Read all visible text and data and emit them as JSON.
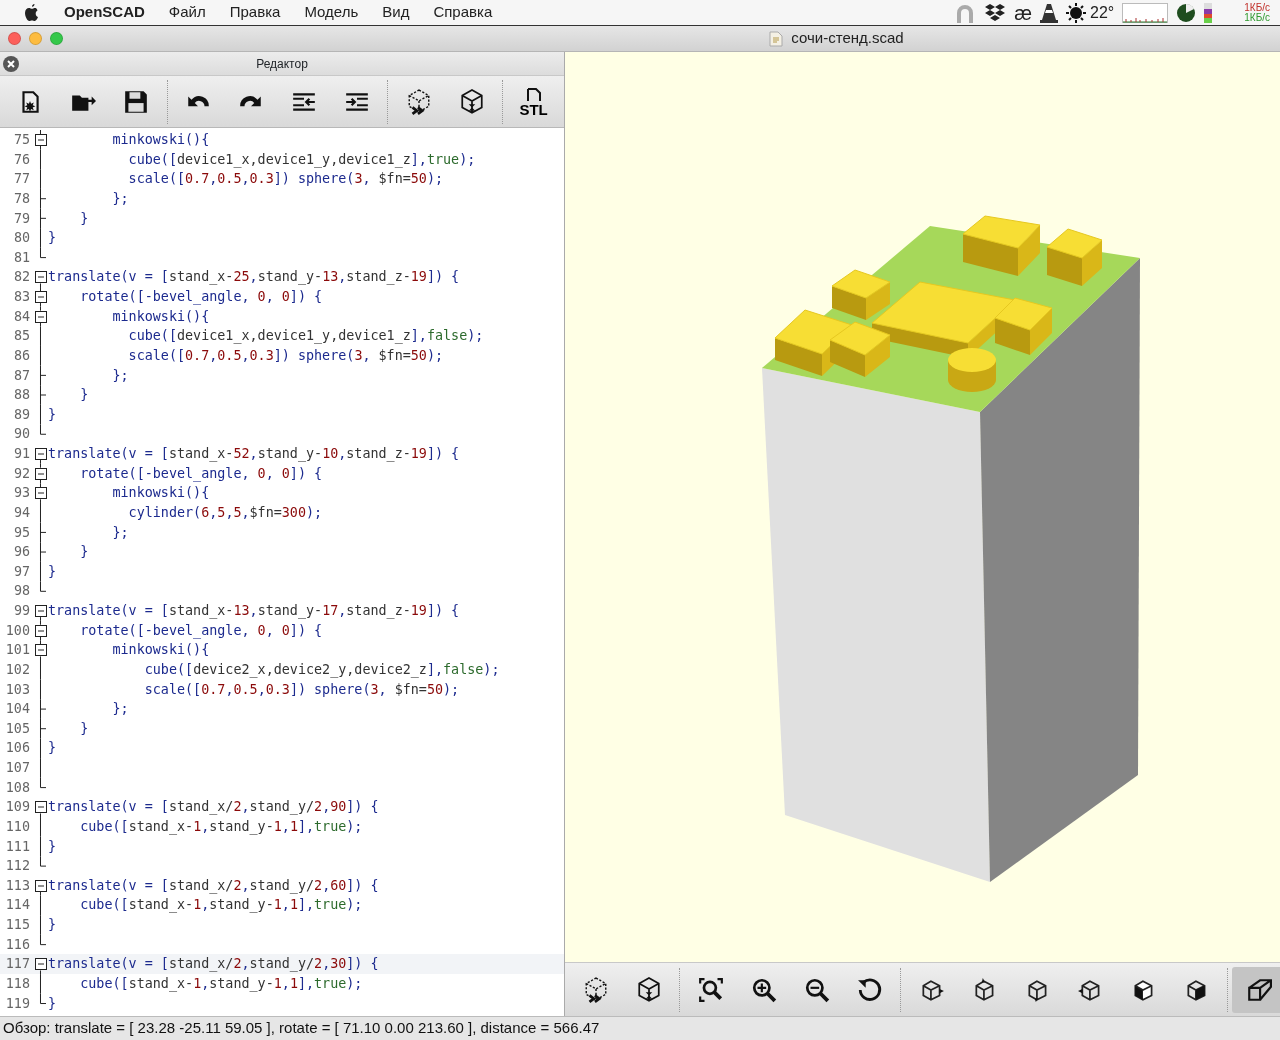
{
  "menu_bar": {
    "app": "OpenSCAD",
    "menus": [
      "Файл",
      "Правка",
      "Модель",
      "Вид",
      "Справка"
    ],
    "status": {
      "text_icon": "æ",
      "temperature": "22°",
      "upload": "1КБ/с",
      "download": "1КБ/с"
    }
  },
  "window": {
    "title": "сочи-стенд.scad"
  },
  "editor": {
    "title": "Редактор",
    "export_label": "STL",
    "lines": [
      {
        "number": "75",
        "kind": "fold-start",
        "current": false,
        "tokens": [
          {
            "text": "        minkowski(){",
            "kind": "function"
          }
        ]
      },
      {
        "number": "76",
        "kind": "fold-line",
        "current": false,
        "tokens": [
          {
            "text": "          cube([",
            "kind": "function"
          },
          {
            "text": "device1_x,device1_y,device1_z",
            "kind": "variable"
          },
          {
            "text": "],",
            "kind": "function"
          },
          {
            "text": "true",
            "kind": "boolean"
          },
          {
            "text": ");",
            "kind": "function"
          }
        ]
      },
      {
        "number": "77",
        "kind": "fold-line",
        "current": false,
        "tokens": [
          {
            "text": "          scale([",
            "kind": "function"
          },
          {
            "text": "0.7",
            "kind": "number"
          },
          {
            "text": ",",
            "kind": "function"
          },
          {
            "text": "0.5",
            "kind": "number"
          },
          {
            "text": ",",
            "kind": "function"
          },
          {
            "text": "0.3",
            "kind": "number"
          },
          {
            "text": "]) sphere(",
            "kind": "function"
          },
          {
            "text": "3",
            "kind": "number"
          },
          {
            "text": ", ",
            "kind": "function"
          },
          {
            "text": "$fn=",
            "kind": "variable"
          },
          {
            "text": "50",
            "kind": "number"
          },
          {
            "text": ");",
            "kind": "function"
          }
        ]
      },
      {
        "number": "78",
        "kind": "fold-tick",
        "current": false,
        "tokens": [
          {
            "text": "        };",
            "kind": "function"
          }
        ]
      },
      {
        "number": "79",
        "kind": "fold-tick",
        "current": false,
        "tokens": [
          {
            "text": "    }",
            "kind": "function"
          }
        ]
      },
      {
        "number": "80",
        "kind": "fold-line",
        "current": false,
        "tokens": [
          {
            "text": "}",
            "kind": "function"
          }
        ]
      },
      {
        "number": "81",
        "kind": "fold-end",
        "current": false
      },
      {
        "number": "82",
        "kind": "fold-start",
        "current": false,
        "tokens": [
          {
            "text": "translate(v = [",
            "kind": "function"
          },
          {
            "text": "stand_x-",
            "kind": "variable"
          },
          {
            "text": "25",
            "kind": "number"
          },
          {
            "text": ",",
            "kind": "function"
          },
          {
            "text": "stand_y-",
            "kind": "variable"
          },
          {
            "text": "13",
            "kind": "number"
          },
          {
            "text": ",",
            "kind": "function"
          },
          {
            "text": "stand_z-",
            "kind": "variable"
          },
          {
            "text": "19",
            "kind": "number"
          },
          {
            "text": "]) {",
            "kind": "function"
          }
        ]
      },
      {
        "number": "83",
        "kind": "fold-start",
        "current": false,
        "tokens": [
          {
            "text": "    rotate([-bevel_angle, ",
            "kind": "function"
          },
          {
            "text": "0",
            "kind": "number"
          },
          {
            "text": ", ",
            "kind": "function"
          },
          {
            "text": "0",
            "kind": "number"
          },
          {
            "text": "]) {",
            "kind": "function"
          }
        ]
      },
      {
        "number": "84",
        "kind": "fold-start",
        "current": false,
        "tokens": [
          {
            "text": "        minkowski(){",
            "kind": "function"
          }
        ]
      },
      {
        "number": "85",
        "kind": "fold-line",
        "current": false,
        "tokens": [
          {
            "text": "          cube([",
            "kind": "function"
          },
          {
            "text": "device1_x,device1_y,device1_z",
            "kind": "variable"
          },
          {
            "text": "],",
            "kind": "function"
          },
          {
            "text": "false",
            "kind": "boolean"
          },
          {
            "text": ");",
            "kind": "function"
          }
        ]
      },
      {
        "number": "86",
        "kind": "fold-line",
        "current": false,
        "tokens": [
          {
            "text": "          scale([",
            "kind": "function"
          },
          {
            "text": "0.7",
            "kind": "number"
          },
          {
            "text": ",",
            "kind": "function"
          },
          {
            "text": "0.5",
            "kind": "number"
          },
          {
            "text": ",",
            "kind": "function"
          },
          {
            "text": "0.3",
            "kind": "number"
          },
          {
            "text": "]) sphere(",
            "kind": "function"
          },
          {
            "text": "3",
            "kind": "number"
          },
          {
            "text": ", ",
            "kind": "function"
          },
          {
            "text": "$fn=",
            "kind": "variable"
          },
          {
            "text": "50",
            "kind": "number"
          },
          {
            "text": ");",
            "kind": "function"
          }
        ]
      },
      {
        "number": "87",
        "kind": "fold-tick",
        "current": false,
        "tokens": [
          {
            "text": "        };",
            "kind": "function"
          }
        ]
      },
      {
        "number": "88",
        "kind": "fold-tick",
        "current": false,
        "tokens": [
          {
            "text": "    }",
            "kind": "function"
          }
        ]
      },
      {
        "number": "89",
        "kind": "fold-line",
        "current": false,
        "tokens": [
          {
            "text": "}",
            "kind": "function"
          }
        ]
      },
      {
        "number": "90",
        "kind": "fold-end",
        "current": false
      },
      {
        "number": "91",
        "kind": "fold-start",
        "current": false,
        "tokens": [
          {
            "text": "translate(v = [",
            "kind": "function"
          },
          {
            "text": "stand_x-",
            "kind": "variable"
          },
          {
            "text": "52",
            "kind": "number"
          },
          {
            "text": ",",
            "kind": "function"
          },
          {
            "text": "stand_y-",
            "kind": "variable"
          },
          {
            "text": "10",
            "kind": "number"
          },
          {
            "text": ",",
            "kind": "function"
          },
          {
            "text": "stand_z-",
            "kind": "variable"
          },
          {
            "text": "19",
            "kind": "number"
          },
          {
            "text": "]) {",
            "kind": "function"
          }
        ]
      },
      {
        "number": "92",
        "kind": "fold-start",
        "current": false,
        "tokens": [
          {
            "text": "    rotate([-bevel_angle, ",
            "kind": "function"
          },
          {
            "text": "0",
            "kind": "number"
          },
          {
            "text": ", ",
            "kind": "function"
          },
          {
            "text": "0",
            "kind": "number"
          },
          {
            "text": "]) {",
            "kind": "function"
          }
        ]
      },
      {
        "number": "93",
        "kind": "fold-start",
        "current": false,
        "tokens": [
          {
            "text": "        minkowski(){",
            "kind": "function"
          }
        ]
      },
      {
        "number": "94",
        "kind": "fold-line",
        "current": false,
        "tokens": [
          {
            "text": "          cylinder(",
            "kind": "function"
          },
          {
            "text": "6",
            "kind": "number"
          },
          {
            "text": ",",
            "kind": "function"
          },
          {
            "text": "5",
            "kind": "number"
          },
          {
            "text": ",",
            "kind": "function"
          },
          {
            "text": "5",
            "kind": "number"
          },
          {
            "text": ",",
            "kind": "function"
          },
          {
            "text": "$fn=",
            "kind": "variable"
          },
          {
            "text": "300",
            "kind": "number"
          },
          {
            "text": ");",
            "kind": "function"
          }
        ]
      },
      {
        "number": "95",
        "kind": "fold-tick",
        "current": false,
        "tokens": [
          {
            "text": "        };",
            "kind": "function"
          }
        ]
      },
      {
        "number": "96",
        "kind": "fold-tick",
        "current": false,
        "tokens": [
          {
            "text": "    }",
            "kind": "function"
          }
        ]
      },
      {
        "number": "97",
        "kind": "fold-line",
        "current": false,
        "tokens": [
          {
            "text": "}",
            "kind": "function"
          }
        ]
      },
      {
        "number": "98",
        "kind": "fold-end",
        "current": false
      },
      {
        "number": "99",
        "kind": "fold-start",
        "current": false,
        "tokens": [
          {
            "text": "translate(v = [",
            "kind": "function"
          },
          {
            "text": "stand_x-",
            "kind": "variable"
          },
          {
            "text": "13",
            "kind": "number"
          },
          {
            "text": ",",
            "kind": "function"
          },
          {
            "text": "stand_y-",
            "kind": "variable"
          },
          {
            "text": "17",
            "kind": "number"
          },
          {
            "text": ",",
            "kind": "function"
          },
          {
            "text": "stand_z-",
            "kind": "variable"
          },
          {
            "text": "19",
            "kind": "number"
          },
          {
            "text": "]) {",
            "kind": "function"
          }
        ]
      },
      {
        "number": "100",
        "kind": "fold-start",
        "current": false,
        "tokens": [
          {
            "text": "    rotate([-bevel_angle, ",
            "kind": "function"
          },
          {
            "text": "0",
            "kind": "number"
          },
          {
            "text": ", ",
            "kind": "function"
          },
          {
            "text": "0",
            "kind": "number"
          },
          {
            "text": "]) {",
            "kind": "function"
          }
        ]
      },
      {
        "number": "101",
        "kind": "fold-start",
        "current": false,
        "tokens": [
          {
            "text": "        minkowski(){",
            "kind": "function"
          }
        ]
      },
      {
        "number": "102",
        "kind": "fold-line",
        "current": false,
        "tokens": [
          {
            "text": "            cube([",
            "kind": "function"
          },
          {
            "text": "device2_x,device2_y,device2_z",
            "kind": "variable"
          },
          {
            "text": "],",
            "kind": "function"
          },
          {
            "text": "false",
            "kind": "boolean"
          },
          {
            "text": ");",
            "kind": "function"
          }
        ]
      },
      {
        "number": "103",
        "kind": "fold-line",
        "current": false,
        "tokens": [
          {
            "text": "            scale([",
            "kind": "function"
          },
          {
            "text": "0.7",
            "kind": "number"
          },
          {
            "text": ",",
            "kind": "function"
          },
          {
            "text": "0.5",
            "kind": "number"
          },
          {
            "text": ",",
            "kind": "function"
          },
          {
            "text": "0.3",
            "kind": "number"
          },
          {
            "text": "]) sphere(",
            "kind": "function"
          },
          {
            "text": "3",
            "kind": "number"
          },
          {
            "text": ", ",
            "kind": "function"
          },
          {
            "text": "$fn=",
            "kind": "variable"
          },
          {
            "text": "50",
            "kind": "number"
          },
          {
            "text": ");",
            "kind": "function"
          }
        ]
      },
      {
        "number": "104",
        "kind": "fold-tick",
        "current": false,
        "tokens": [
          {
            "text": "        };",
            "kind": "function"
          }
        ]
      },
      {
        "number": "105",
        "kind": "fold-tick",
        "current": false,
        "tokens": [
          {
            "text": "    }",
            "kind": "function"
          }
        ]
      },
      {
        "number": "106",
        "kind": "fold-line",
        "current": false,
        "tokens": [
          {
            "text": "}",
            "kind": "function"
          }
        ]
      },
      {
        "number": "107",
        "kind": "fold-line",
        "current": false
      },
      {
        "number": "108",
        "kind": "fold-end",
        "current": false
      },
      {
        "number": "109",
        "kind": "fold-start",
        "current": false,
        "tokens": [
          {
            "text": "translate(v = [",
            "kind": "function"
          },
          {
            "text": "stand_x/",
            "kind": "variable"
          },
          {
            "text": "2",
            "kind": "number"
          },
          {
            "text": ",",
            "kind": "function"
          },
          {
            "text": "stand_y/",
            "kind": "variable"
          },
          {
            "text": "2",
            "kind": "number"
          },
          {
            "text": ",",
            "kind": "function"
          },
          {
            "text": "90",
            "kind": "number"
          },
          {
            "text": "]) {",
            "kind": "function"
          }
        ]
      },
      {
        "number": "110",
        "kind": "fold-line",
        "current": false,
        "tokens": [
          {
            "text": "    cube([",
            "kind": "function"
          },
          {
            "text": "stand_x-",
            "kind": "variable"
          },
          {
            "text": "1",
            "kind": "number"
          },
          {
            "text": ",",
            "kind": "function"
          },
          {
            "text": "stand_y-",
            "kind": "variable"
          },
          {
            "text": "1",
            "kind": "number"
          },
          {
            "text": ",",
            "kind": "function"
          },
          {
            "text": "1",
            "kind": "number"
          },
          {
            "text": "],",
            "kind": "function"
          },
          {
            "text": "true",
            "kind": "boolean"
          },
          {
            "text": ");",
            "kind": "function"
          }
        ]
      },
      {
        "number": "111",
        "kind": "fold-line",
        "current": false,
        "tokens": [
          {
            "text": "}",
            "kind": "function"
          }
        ]
      },
      {
        "number": "112",
        "kind": "fold-end",
        "current": false
      },
      {
        "number": "113",
        "kind": "fold-start",
        "current": false,
        "tokens": [
          {
            "text": "translate(v = [",
            "kind": "function"
          },
          {
            "text": "stand_x/",
            "kind": "variable"
          },
          {
            "text": "2",
            "kind": "number"
          },
          {
            "text": ",",
            "kind": "function"
          },
          {
            "text": "stand_y/",
            "kind": "variable"
          },
          {
            "text": "2",
            "kind": "number"
          },
          {
            "text": ",",
            "kind": "function"
          },
          {
            "text": "60",
            "kind": "number"
          },
          {
            "text": "]) {",
            "kind": "function"
          }
        ]
      },
      {
        "number": "114",
        "kind": "fold-line",
        "current": false,
        "tokens": [
          {
            "text": "    cube([",
            "kind": "function"
          },
          {
            "text": "stand_x-",
            "kind": "variable"
          },
          {
            "text": "1",
            "kind": "number"
          },
          {
            "text": ",",
            "kind": "function"
          },
          {
            "text": "stand_y-",
            "kind": "variable"
          },
          {
            "text": "1",
            "kind": "number"
          },
          {
            "text": ",",
            "kind": "function"
          },
          {
            "text": "1",
            "kind": "number"
          },
          {
            "text": "],",
            "kind": "function"
          },
          {
            "text": "true",
            "kind": "boolean"
          },
          {
            "text": ");",
            "kind": "function"
          }
        ]
      },
      {
        "number": "115",
        "kind": "fold-line",
        "current": false,
        "tokens": [
          {
            "text": "}",
            "kind": "function"
          }
        ]
      },
      {
        "number": "116",
        "kind": "fold-end",
        "current": false
      },
      {
        "number": "117",
        "kind": "fold-start",
        "current": true,
        "tokens": [
          {
            "text": "translate(v = [",
            "kind": "function"
          },
          {
            "text": "stand_x/",
            "kind": "variable"
          },
          {
            "text": "2",
            "kind": "number"
          },
          {
            "text": ",",
            "kind": "function"
          },
          {
            "text": "stand_y/",
            "kind": "variable"
          },
          {
            "text": "2",
            "kind": "number"
          },
          {
            "text": ",",
            "kind": "function"
          },
          {
            "text": "30",
            "kind": "number"
          },
          {
            "text": "]) {",
            "kind": "function"
          }
        ]
      },
      {
        "number": "118",
        "kind": "fold-line",
        "current": false,
        "tokens": [
          {
            "text": "    cube([",
            "kind": "function"
          },
          {
            "text": "stand_x-",
            "kind": "variable"
          },
          {
            "text": "1",
            "kind": "number"
          },
          {
            "text": ",",
            "kind": "function"
          },
          {
            "text": "stand_y-",
            "kind": "variable"
          },
          {
            "text": "1",
            "kind": "number"
          },
          {
            "text": ",",
            "kind": "function"
          },
          {
            "text": "1",
            "kind": "number"
          },
          {
            "text": "],",
            "kind": "function"
          },
          {
            "text": "true",
            "kind": "boolean"
          },
          {
            "text": ");",
            "kind": "function"
          }
        ]
      },
      {
        "number": "119",
        "kind": "fold-end",
        "current": false,
        "tokens": [
          {
            "text": "}",
            "kind": "function"
          }
        ]
      }
    ]
  },
  "viewer": {
    "perspective": {
      "selected": true
    }
  },
  "status_bar": "Обзор: translate = [ 23.28 -25.11 59.05 ], rotate = [ 71.10 0.00 213.60 ], distance = 566.47"
}
